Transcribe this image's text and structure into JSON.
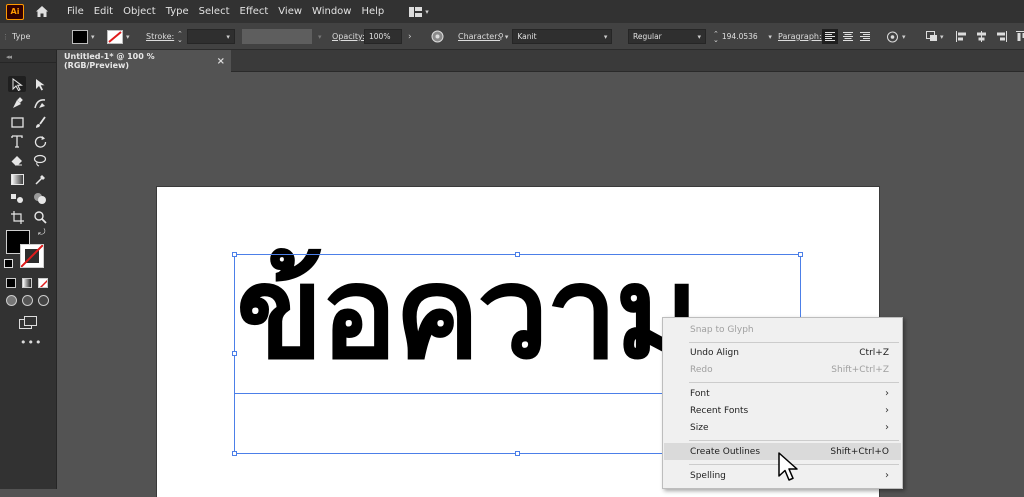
{
  "app": {
    "logo_text": "Ai"
  },
  "menubar": {
    "items": [
      "File",
      "Edit",
      "Object",
      "Type",
      "Select",
      "Effect",
      "View",
      "Window",
      "Help"
    ]
  },
  "control_bar": {
    "tool_label": "Type",
    "stroke_label": "Stroke:",
    "opacity_label": "Opacity:",
    "opacity_value": "100%",
    "character_label": "Character:",
    "font_value": "Kanit",
    "style_value": "Regular",
    "size_value": "194.0536",
    "paragraph_label": "Paragraph:"
  },
  "document": {
    "tab_title": "Untitled-1* @ 100 % (RGB/Preview)",
    "close_glyph": "×",
    "art_text": "ข้อความ"
  },
  "context_menu": {
    "items": [
      {
        "label": "Snap to Glyph",
        "shortcut": "",
        "disabled": true,
        "submenu": false
      },
      {
        "label": "Undo Align",
        "shortcut": "Ctrl+Z",
        "disabled": false,
        "submenu": false
      },
      {
        "label": "Redo",
        "shortcut": "Shift+Ctrl+Z",
        "disabled": true,
        "submenu": false
      },
      {
        "label": "Font",
        "shortcut": "",
        "disabled": false,
        "submenu": true
      },
      {
        "label": "Recent Fonts",
        "shortcut": "",
        "disabled": false,
        "submenu": true
      },
      {
        "label": "Size",
        "shortcut": "",
        "disabled": false,
        "submenu": true
      },
      {
        "label": "Create Outlines",
        "shortcut": "Shift+Ctrl+O",
        "disabled": false,
        "submenu": false
      },
      {
        "label": "Spelling",
        "shortcut": "",
        "disabled": false,
        "submenu": true
      }
    ],
    "submenu_glyph": "›"
  },
  "colors": {
    "accent_selection": "#4c7fe8",
    "fill_color": "#000000",
    "logo_orange": "#ff9a00"
  },
  "icons": {
    "home": "home-icon",
    "workspace": "workspace-switcher-icon",
    "selection_tool": "selection-tool-icon",
    "type_tool": "type-tool-icon",
    "zoom_tool": "zoom-tool-icon"
  }
}
